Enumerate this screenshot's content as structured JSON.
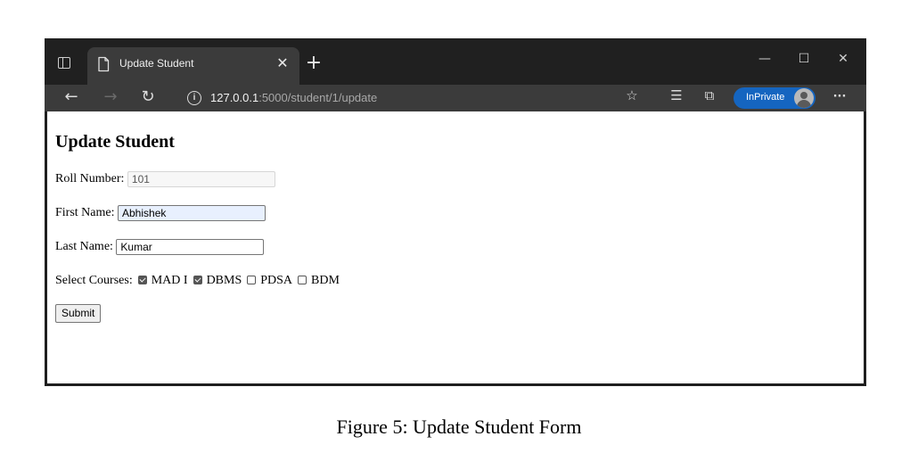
{
  "browser": {
    "tab_title": "Update Student",
    "tab_close_glyph": "✕",
    "new_tab_glyph": "+",
    "window_controls": {
      "minimize": "—",
      "maximize": "☐",
      "close": "✕"
    },
    "nav": {
      "back": "←",
      "forward": "→",
      "refresh": "↻"
    },
    "url_host": "127.0.0.1",
    "url_rest": ":5000/student/1/update",
    "inprivate_label": "InPrivate",
    "more_glyph": "···",
    "toolbar_icons": {
      "favorite": "☆",
      "favorites_list": "☰",
      "collections": "⧉"
    }
  },
  "page": {
    "heading": "Update Student",
    "roll_label": "Roll Number:",
    "roll_value": "101",
    "first_label": "First Name:",
    "first_value": "Abhishek",
    "last_label": "Last Name:",
    "last_value": "Kumar",
    "courses_label": "Select Courses:",
    "courses": [
      {
        "label": "MAD I",
        "checked": true
      },
      {
        "label": "DBMS",
        "checked": true
      },
      {
        "label": "PDSA",
        "checked": false
      },
      {
        "label": "BDM",
        "checked": false
      }
    ],
    "submit_label": "Submit"
  },
  "caption": "Figure 5: Update Student Form",
  "colors": {
    "titlebar": "#202020",
    "active_tab": "#3b3b3b",
    "inprivate_badge": "#1565c0",
    "autofill_bg": "#e8f0fe"
  }
}
